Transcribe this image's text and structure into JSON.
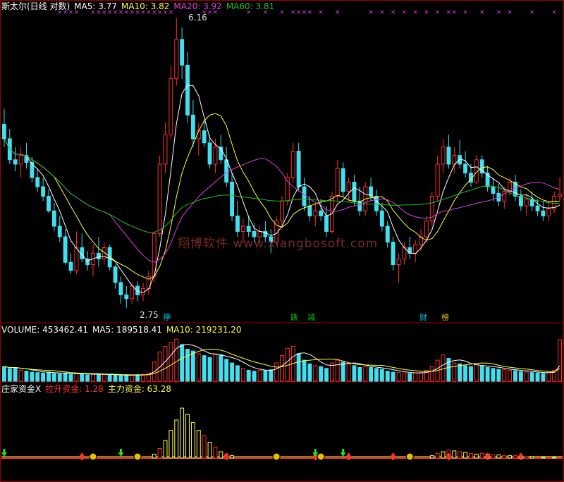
{
  "price_header": {
    "title": "斯太尔(日线 对数)",
    "ma5": "MA5: 3.77",
    "ma10": "MA10: 3.82",
    "ma20": "MA20: 3.92",
    "ma60": "MA60: 3.81",
    "high_label": "6.16",
    "low_label": "2.75"
  },
  "volume_header": {
    "volume": "VOLUME: 453462.41",
    "ma5": "MA5: 189518.41",
    "ma10": "MA10: 219231.20"
  },
  "indicator_header": {
    "title": "庄家资金X",
    "lift": "拉升资金: 1.28",
    "main": "主力资金: 63.28"
  },
  "event_markers": [
    {
      "text": "停",
      "color": "#00c8e0"
    },
    {
      "text": "跌",
      "color": "#00c800"
    },
    {
      "text": "减",
      "color": "#00c800"
    },
    {
      "text": "财",
      "color": "#00c8e0"
    },
    {
      "text": "榜",
      "color": "#e8c000"
    }
  ],
  "watermark": "翔博软件 www.xiangbosoft.com",
  "colors": {
    "up": "#ff3030",
    "down": "#40e0f0",
    "ma5": "#ffffff",
    "ma10": "#ffff40",
    "ma20": "#e040e0",
    "ma60": "#20c020",
    "grid": "#a00000",
    "bg": "#000000"
  },
  "chart_data": [
    {
      "type": "candlestick",
      "title": "斯太尔(日线 对数)",
      "y_scale": "log",
      "ylim": [
        2.7,
        6.2
      ],
      "annotations": [
        {
          "value": 6.16,
          "label": "6.16"
        },
        {
          "value": 2.75,
          "label": "2.75"
        }
      ],
      "x_count": 101,
      "ohlc": [
        [
          4.58,
          4.78,
          4.3,
          4.4
        ],
        [
          4.4,
          4.52,
          4.1,
          4.15
        ],
        [
          4.15,
          4.3,
          4.02,
          4.1
        ],
        [
          4.1,
          4.3,
          3.95,
          4.2
        ],
        [
          4.2,
          4.35,
          4.05,
          4.12
        ],
        [
          4.12,
          4.18,
          3.9,
          3.95
        ],
        [
          3.95,
          4.05,
          3.8,
          3.85
        ],
        [
          3.85,
          3.95,
          3.7,
          3.75
        ],
        [
          3.75,
          3.82,
          3.58,
          3.6
        ],
        [
          3.6,
          3.68,
          3.4,
          3.45
        ],
        [
          3.45,
          3.55,
          3.3,
          3.35
        ],
        [
          3.35,
          3.42,
          3.1,
          3.12
        ],
        [
          3.12,
          3.2,
          3.02,
          3.05
        ],
        [
          3.05,
          3.4,
          3.02,
          3.25
        ],
        [
          3.25,
          3.38,
          3.12,
          3.15
        ],
        [
          3.15,
          3.22,
          3.05,
          3.1
        ],
        [
          3.1,
          3.28,
          3.0,
          3.2
        ],
        [
          3.2,
          3.35,
          3.08,
          3.15
        ],
        [
          3.15,
          3.3,
          3.1,
          3.25
        ],
        [
          3.25,
          3.28,
          3.05,
          3.08
        ],
        [
          3.08,
          3.1,
          2.9,
          2.95
        ],
        [
          2.95,
          3.0,
          2.78,
          2.85
        ],
        [
          2.85,
          2.92,
          2.75,
          2.82
        ],
        [
          2.82,
          2.95,
          2.78,
          2.92
        ],
        [
          2.92,
          2.96,
          2.8,
          2.85
        ],
        [
          2.85,
          2.95,
          2.8,
          2.9
        ],
        [
          2.9,
          3.05,
          2.85,
          3.0
        ],
        [
          3.0,
          3.4,
          2.95,
          3.38
        ],
        [
          3.38,
          4.2,
          3.35,
          4.1
        ],
        [
          4.1,
          4.6,
          4.0,
          4.45
        ],
        [
          4.45,
          5.4,
          4.4,
          5.2
        ],
        [
          5.2,
          6.16,
          5.1,
          5.8
        ],
        [
          5.8,
          6.0,
          5.2,
          5.4
        ],
        [
          5.4,
          5.6,
          4.6,
          4.7
        ],
        [
          4.7,
          4.9,
          4.3,
          4.4
        ],
        [
          4.4,
          4.6,
          4.2,
          4.5
        ],
        [
          4.5,
          4.62,
          4.3,
          4.35
        ],
        [
          4.35,
          4.45,
          4.05,
          4.1
        ],
        [
          4.1,
          4.4,
          4.0,
          4.3
        ],
        [
          4.3,
          4.45,
          4.1,
          4.15
        ],
        [
          4.15,
          4.3,
          3.85,
          3.9
        ],
        [
          3.9,
          4.0,
          3.5,
          3.55
        ],
        [
          3.55,
          3.7,
          3.35,
          3.4
        ],
        [
          3.4,
          3.52,
          3.3,
          3.45
        ],
        [
          3.45,
          3.55,
          3.35,
          3.4
        ],
        [
          3.4,
          3.48,
          3.3,
          3.35
        ],
        [
          3.35,
          3.45,
          3.28,
          3.4
        ],
        [
          3.4,
          3.5,
          3.3,
          3.35
        ],
        [
          3.35,
          3.42,
          3.2,
          3.3
        ],
        [
          3.3,
          3.55,
          3.28,
          3.5
        ],
        [
          3.5,
          3.75,
          3.45,
          3.7
        ],
        [
          3.7,
          4.0,
          3.65,
          3.95
        ],
        [
          3.95,
          4.35,
          3.9,
          4.25
        ],
        [
          4.25,
          4.35,
          3.8,
          3.85
        ],
        [
          3.85,
          3.95,
          3.6,
          3.65
        ],
        [
          3.65,
          3.75,
          3.5,
          3.55
        ],
        [
          3.55,
          3.68,
          3.45,
          3.6
        ],
        [
          3.6,
          3.72,
          3.5,
          3.55
        ],
        [
          3.55,
          3.65,
          3.35,
          3.4
        ],
        [
          3.4,
          3.8,
          3.38,
          3.75
        ],
        [
          3.75,
          4.15,
          3.7,
          4.05
        ],
        [
          4.05,
          4.12,
          3.75,
          3.8
        ],
        [
          3.8,
          3.95,
          3.7,
          3.9
        ],
        [
          3.9,
          3.98,
          3.65,
          3.7
        ],
        [
          3.7,
          3.85,
          3.55,
          3.6
        ],
        [
          3.6,
          3.9,
          3.55,
          3.85
        ],
        [
          3.85,
          3.95,
          3.7,
          3.75
        ],
        [
          3.75,
          3.82,
          3.55,
          3.6
        ],
        [
          3.6,
          3.68,
          3.4,
          3.45
        ],
        [
          3.45,
          3.5,
          3.25,
          3.3
        ],
        [
          3.3,
          3.35,
          3.05,
          3.1
        ],
        [
          3.1,
          3.2,
          2.95,
          3.15
        ],
        [
          3.15,
          3.3,
          3.1,
          3.25
        ],
        [
          3.25,
          3.35,
          3.15,
          3.2
        ],
        [
          3.2,
          3.32,
          3.12,
          3.28
        ],
        [
          3.28,
          3.42,
          3.22,
          3.35
        ],
        [
          3.35,
          3.55,
          3.3,
          3.5
        ],
        [
          3.5,
          3.8,
          3.45,
          3.75
        ],
        [
          3.75,
          4.2,
          3.7,
          4.1
        ],
        [
          4.1,
          4.4,
          4.0,
          4.3
        ],
        [
          4.3,
          4.45,
          4.05,
          4.1
        ],
        [
          4.1,
          4.3,
          4.0,
          4.2
        ],
        [
          4.2,
          4.38,
          4.05,
          4.1
        ],
        [
          4.1,
          4.25,
          3.95,
          4.0
        ],
        [
          4.0,
          4.1,
          3.85,
          3.9
        ],
        [
          3.9,
          4.2,
          3.88,
          4.15
        ],
        [
          4.15,
          4.2,
          3.95,
          4.0
        ],
        [
          4.0,
          4.08,
          3.8,
          3.85
        ],
        [
          3.85,
          3.95,
          3.7,
          3.78
        ],
        [
          3.78,
          3.88,
          3.65,
          3.7
        ],
        [
          3.7,
          3.85,
          3.62,
          3.8
        ],
        [
          3.8,
          3.95,
          3.75,
          3.9
        ],
        [
          3.9,
          3.98,
          3.7,
          3.75
        ],
        [
          3.75,
          3.82,
          3.6,
          3.65
        ],
        [
          3.65,
          3.78,
          3.55,
          3.72
        ],
        [
          3.72,
          3.8,
          3.6,
          3.65
        ],
        [
          3.65,
          3.72,
          3.55,
          3.6
        ],
        [
          3.6,
          3.7,
          3.5,
          3.55
        ],
        [
          3.55,
          3.68,
          3.5,
          3.62
        ],
        [
          3.62,
          3.8,
          3.58,
          3.75
        ],
        [
          3.75,
          3.95,
          3.7,
          3.77
        ]
      ],
      "series": [
        {
          "name": "MA5",
          "value": 3.77
        },
        {
          "name": "MA10",
          "value": 3.82
        },
        {
          "name": "MA20",
          "value": 3.92
        },
        {
          "name": "MA60",
          "value": 3.81
        }
      ]
    },
    {
      "type": "bar",
      "title": "VOLUME",
      "last_value": 453462.41,
      "ylim": [
        0,
        500000
      ],
      "values": [
        160000,
        140000,
        150000,
        120000,
        110000,
        100000,
        95000,
        90000,
        100000,
        85000,
        80000,
        90000,
        75000,
        85000,
        80000,
        70000,
        75000,
        80000,
        72000,
        68000,
        65000,
        62000,
        60000,
        70000,
        72000,
        75000,
        90000,
        210000,
        320000,
        380000,
        420000,
        460000,
        400000,
        350000,
        330000,
        300000,
        280000,
        260000,
        300000,
        290000,
        240000,
        200000,
        170000,
        140000,
        120000,
        110000,
        120000,
        115000,
        125000,
        200000,
        280000,
        360000,
        380000,
        300000,
        230000,
        190000,
        170000,
        160000,
        140000,
        200000,
        230000,
        210000,
        190000,
        170000,
        150000,
        160000,
        150000,
        140000,
        130000,
        110000,
        100000,
        95000,
        90000,
        85000,
        90000,
        95000,
        120000,
        160000,
        230000,
        290000,
        250000,
        200000,
        190000,
        170000,
        160000,
        180000,
        165000,
        150000,
        140000,
        130000,
        125000,
        120000,
        115000,
        105000,
        100000,
        95000,
        90000,
        85000,
        95000,
        120000,
        453462
      ],
      "series": [
        {
          "name": "MA5",
          "value": 189518.41
        },
        {
          "name": "MA10",
          "value": 219231.2
        }
      ]
    },
    {
      "type": "bar",
      "title": "庄家资金X",
      "ylim": [
        0,
        80
      ],
      "values": [
        0,
        0,
        0,
        0,
        0,
        0,
        0,
        0,
        0,
        0,
        0,
        0,
        0,
        0,
        0,
        0,
        0,
        0,
        0,
        0,
        0,
        0,
        0,
        0,
        0,
        0,
        0,
        5,
        12,
        22,
        35,
        48,
        63,
        55,
        45,
        35,
        28,
        20,
        14,
        8,
        5,
        3,
        0,
        0,
        0,
        0,
        0,
        0,
        0,
        0,
        0,
        0,
        0,
        0,
        0,
        0,
        0,
        0,
        0,
        0,
        0,
        0,
        0,
        0,
        0,
        0,
        0,
        0,
        0,
        0,
        0,
        0,
        0,
        0,
        0,
        0,
        0,
        3,
        6,
        8,
        10,
        9,
        8,
        7,
        6,
        5,
        6,
        5,
        4,
        4,
        3,
        3,
        3,
        2,
        2,
        2,
        1,
        1,
        1,
        1,
        1
      ],
      "series": [
        {
          "name": "拉升资金",
          "value": 1.28
        },
        {
          "name": "主力资金",
          "value": 63.28
        }
      ]
    }
  ]
}
